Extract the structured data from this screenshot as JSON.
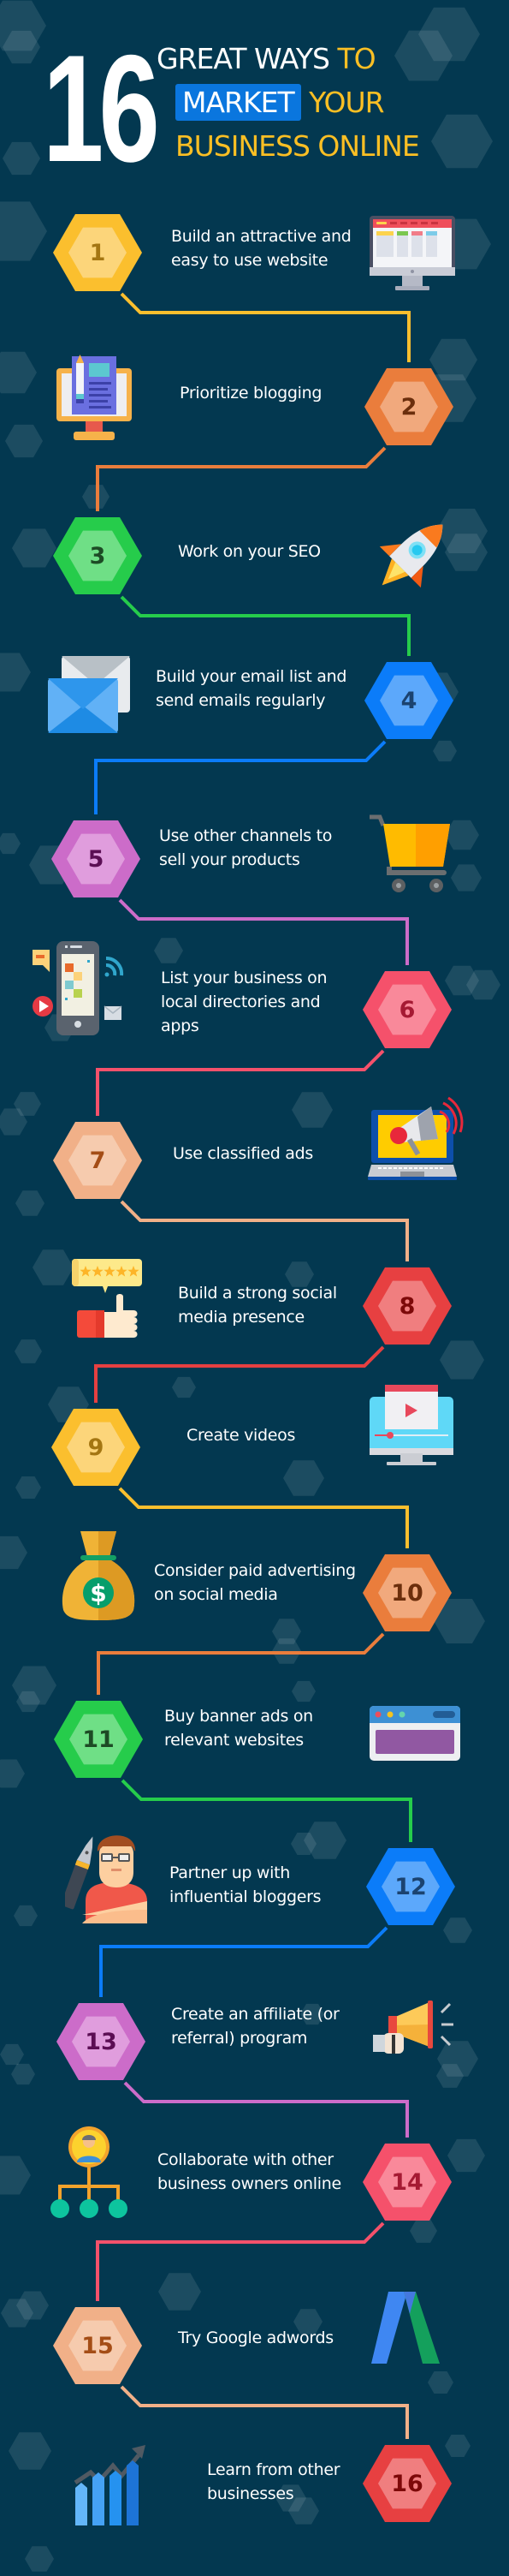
{
  "header": {
    "big_number": "16",
    "line1_white": "GREAT WAYS",
    "line1_yellow": "TO",
    "line2_highlight": "MARKET",
    "line2_yellow": "YOUR",
    "line3_yellow": "BUSINESS ONLINE"
  },
  "colors": {
    "background": "#033850",
    "accent_blue": "#0a76de",
    "accent_yellow": "#fbbf24"
  },
  "steps": [
    {
      "number": "1",
      "text": "Build an attractive and easy to use website",
      "icon": "website-monitor-icon",
      "color": "#fbbf2e",
      "inner": "#fcd57a",
      "numColor": "#a47612"
    },
    {
      "number": "2",
      "text": "Prioritize blogging",
      "icon": "blog-monitor-icon",
      "color": "#ea7d3c",
      "inner": "#f1a97d",
      "numColor": "#6b2e0c"
    },
    {
      "number": "3",
      "text": "Work on your SEO",
      "icon": "rocket-icon",
      "color": "#26cc4b",
      "inner": "#6fdf86",
      "numColor": "#1d4b25"
    },
    {
      "number": "4",
      "text": "Build your email list and send emails regularly",
      "icon": "email-envelope-icon",
      "color": "#0b7cf9",
      "inner": "#5ca8fb",
      "numColor": "#1b4370"
    },
    {
      "number": "5",
      "text": "Use other channels to sell your products",
      "icon": "shopping-cart-icon",
      "color": "#cc6cc9",
      "inner": "#e09ddd",
      "numColor": "#5b0e54"
    },
    {
      "number": "6",
      "text": "List your business on local directories and apps",
      "icon": "mobile-apps-icon",
      "color": "#f5516b",
      "inner": "#f9899a",
      "numColor": "#a51a33"
    },
    {
      "number": "7",
      "text": "Use classified ads",
      "icon": "laptop-megaphone-icon",
      "color": "#f1b088",
      "inner": "#f6cbae",
      "numColor": "#a44d16"
    },
    {
      "number": "8",
      "text": "Build a strong social media presence",
      "icon": "thumbs-up-rating-icon",
      "color": "#e74041",
      "inner": "#f07e7f",
      "numColor": "#7d0909"
    },
    {
      "number": "9",
      "text": "Create videos",
      "icon": "video-monitor-icon",
      "color": "#fbbf2e",
      "inner": "#fcd57a",
      "numColor": "#a47612"
    },
    {
      "number": "10",
      "text": "Consider paid advertising on social media",
      "icon": "money-bag-icon",
      "color": "#ea7d3c",
      "inner": "#f1a97d",
      "numColor": "#6b2e0c"
    },
    {
      "number": "11",
      "text": "Buy banner ads on relevant websites",
      "icon": "browser-banner-icon",
      "color": "#26cc4b",
      "inner": "#6fdf86",
      "numColor": "#1d4b25"
    },
    {
      "number": "12",
      "text": "Partner up with influential bloggers",
      "icon": "blogger-avatar-icon",
      "color": "#0b7cf9",
      "inner": "#5ca8fb",
      "numColor": "#1b4370"
    },
    {
      "number": "13",
      "text": "Create an affiliate (or referral) program",
      "icon": "hand-megaphone-icon",
      "color": "#cc6cc9",
      "inner": "#e09ddd",
      "numColor": "#5b0e54"
    },
    {
      "number": "14",
      "text": "Collaborate with other business owners online",
      "icon": "network-people-icon",
      "color": "#f5516b",
      "inner": "#f9899a",
      "numColor": "#a51a33"
    },
    {
      "number": "15",
      "text": "Try Google adwords",
      "icon": "google-adwords-icon",
      "color": "#f1b088",
      "inner": "#f6cbae",
      "numColor": "#a44d16"
    },
    {
      "number": "16",
      "text": "Learn from other businesses",
      "icon": "growth-chart-icon",
      "color": "#e74041",
      "inner": "#f07e7f",
      "numColor": "#7d0909"
    }
  ]
}
